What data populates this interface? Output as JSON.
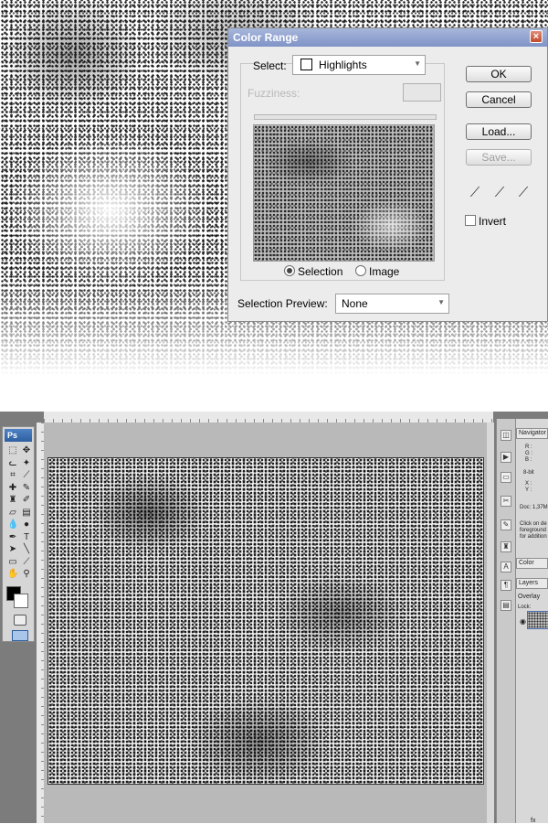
{
  "dialog": {
    "title": "Color Range",
    "select_label": "Select:",
    "select_value": "Highlights",
    "fuzziness_label": "Fuzziness:",
    "radio_selection": "Selection",
    "radio_image": "Image",
    "selection_preview_label": "Selection Preview:",
    "selection_preview_value": "None",
    "buttons": {
      "ok": "OK",
      "cancel": "Cancel",
      "load": "Load...",
      "save": "Save..."
    },
    "invert_label": "Invert"
  },
  "toolbox": {
    "logo": "Ps",
    "tools": [
      {
        "name": "marquee-tool-icon",
        "glyph": "⬚"
      },
      {
        "name": "move-tool-icon",
        "glyph": "✥"
      },
      {
        "name": "lasso-tool-icon",
        "glyph": "ᓚ"
      },
      {
        "name": "magic-wand-tool-icon",
        "glyph": "✦"
      },
      {
        "name": "crop-tool-icon",
        "glyph": "⌗"
      },
      {
        "name": "slice-tool-icon",
        "glyph": "⟋"
      },
      {
        "name": "healing-tool-icon",
        "glyph": "✚"
      },
      {
        "name": "brush-tool-icon",
        "glyph": "✎"
      },
      {
        "name": "stamp-tool-icon",
        "glyph": "♜"
      },
      {
        "name": "history-brush-icon",
        "glyph": "✐"
      },
      {
        "name": "eraser-tool-icon",
        "glyph": "▱"
      },
      {
        "name": "gradient-tool-icon",
        "glyph": "▤"
      },
      {
        "name": "blur-tool-icon",
        "glyph": "💧"
      },
      {
        "name": "dodge-tool-icon",
        "glyph": "●"
      },
      {
        "name": "pen-tool-icon",
        "glyph": "✒"
      },
      {
        "name": "type-tool-icon",
        "glyph": "T"
      },
      {
        "name": "path-select-icon",
        "glyph": "➤"
      },
      {
        "name": "line-tool-icon",
        "glyph": "╲"
      },
      {
        "name": "notes-tool-icon",
        "glyph": "▭"
      },
      {
        "name": "eyedropper-tool-icon",
        "glyph": "⟋"
      },
      {
        "name": "hand-tool-icon",
        "glyph": "✋"
      },
      {
        "name": "zoom-tool-icon",
        "glyph": "⚲"
      }
    ]
  },
  "panels": {
    "navigator_tab": "Navigator",
    "info_rgb": [
      "R :",
      "G :",
      "B :"
    ],
    "info_bit": "8-bit",
    "info_xy": [
      "X :",
      "Y :"
    ],
    "info_doc": "Doc: 1,37M",
    "info_hint": [
      "Click on de",
      "foreground",
      "for addition"
    ],
    "color_tab": "Color",
    "layers_tab": "Layers",
    "blend_mode": "Overlay",
    "lock_label": "Lock:",
    "fx_label": "fx"
  },
  "colors": {
    "title_bar": "#8496cb",
    "dialog_bg": "#ececec",
    "toolbox_bg": "#d6d6d6",
    "workspace_bg": "#7c7c7c"
  }
}
